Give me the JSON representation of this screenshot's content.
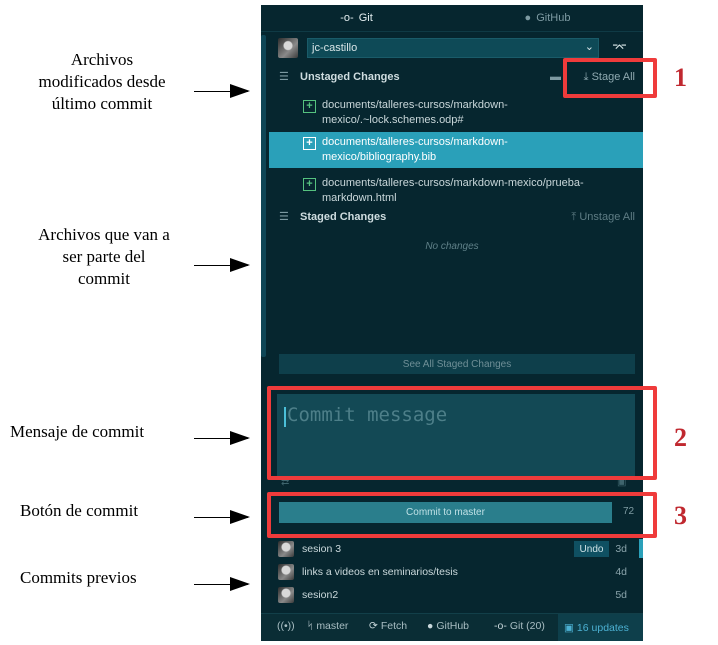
{
  "annotations": {
    "modified": "Archivos\nmodificados desde\núltimo commit",
    "staged": "Archivos que van a\nser parte del\ncommit",
    "message": "Mensaje de commit",
    "button": "Botón de commit",
    "previous": "Commits previos",
    "n1": "1",
    "n2": "2",
    "n3": "3",
    "highlight_color": "#ef3b3b",
    "number_color": "#c0282f"
  },
  "tabs": [
    {
      "icon": "git-commit-icon",
      "label": "Git"
    },
    {
      "icon": "github-icon",
      "label": "GitHub"
    }
  ],
  "repo": {
    "user": "jc-castillo"
  },
  "unstaged": {
    "title": "Unstaged Changes",
    "action": "Stage All",
    "files": [
      "documents/talleres-cursos/markdown-\nmexico/.~lock.schemes.odp#",
      "documents/talleres-cursos/markdown-\nmexico/bibliography.bib",
      "documents/talleres-cursos/markdown-mexico/prueba-\nmarkdown.html"
    ]
  },
  "staged": {
    "title": "Staged Changes",
    "action": "Unstage All",
    "empty": "No changes",
    "see_all": "See All Staged Changes"
  },
  "commit": {
    "placeholder": "Commit message",
    "button": "Commit to master",
    "count": "72"
  },
  "history": [
    {
      "message": "sesion 3",
      "age": "3d",
      "undo": "Undo"
    },
    {
      "message": "links a videos en seminarios/tesis",
      "age": "4d"
    },
    {
      "message": "sesion2",
      "age": "5d"
    }
  ],
  "status": {
    "branch": "master",
    "fetch": "Fetch",
    "github": "GitHub",
    "git": "Git (20)",
    "updates": "16 updates"
  },
  "colors": {
    "panel_bg": "#06262f",
    "selected_row": "#2aa0b9",
    "accent": "#4cb1d3"
  }
}
